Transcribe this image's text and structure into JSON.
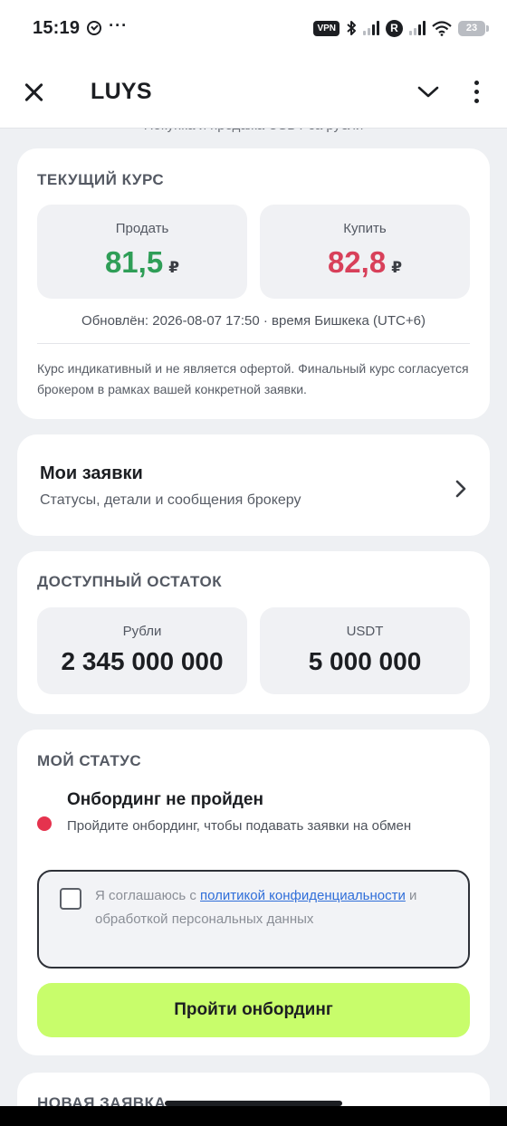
{
  "status_bar": {
    "time": "15:19",
    "more": "···",
    "vpn": "VPN",
    "r_badge": "R",
    "battery": "23"
  },
  "app_bar": {
    "title": "LUYS"
  },
  "partial_header_text": "Покупка и продажа USDT за рубли",
  "rates": {
    "title": "ТЕКУЩИЙ КУРС",
    "sell_label": "Продать",
    "sell_value": "81,5",
    "buy_label": "Купить",
    "buy_value": "82,8",
    "currency": "₽",
    "sell_color": "#2f9e57",
    "buy_color": "#d8405a",
    "updated": "Обновлён: 2026-08-07 17:50 · время Бишкека (UTC+6)",
    "disclaimer": "Курс индикативный и не является офертой. Финальный курс согласуется брокером в рамках вашей конкретной заявки."
  },
  "my_requests": {
    "title": "Мои заявки",
    "subtitle": "Статусы, детали и сообщения брокеру"
  },
  "balance": {
    "title": "ДОСТУПНЫЙ ОСТАТОК",
    "rub_label": "Рубли",
    "rub_value": "2 345 000 000",
    "usdt_label": "USDT",
    "usdt_value": "5 000 000"
  },
  "status": {
    "title": "МОЙ СТАТУС",
    "headline": "Онбординг не пройден",
    "text": "Пройдите онбординг, чтобы подавать заявки на обмен",
    "dot_color": "#e5334e",
    "consent_prefix": "Я соглашаюсь с ",
    "consent_link": "политикой конфиденциальности",
    "consent_suffix": " и обработкой персональных данных",
    "button": "Пройти онбординг",
    "button_color": "#c8fd6b"
  },
  "new_request": {
    "title": "НОВАЯ ЗАЯВКА"
  },
  "icons": [
    "check-circle-icon",
    "bluetooth-icon",
    "signal-icon",
    "wifi-icon",
    "battery-icon",
    "close-icon",
    "chevron-down-icon",
    "more-vertical-icon",
    "chevron-right-icon"
  ]
}
